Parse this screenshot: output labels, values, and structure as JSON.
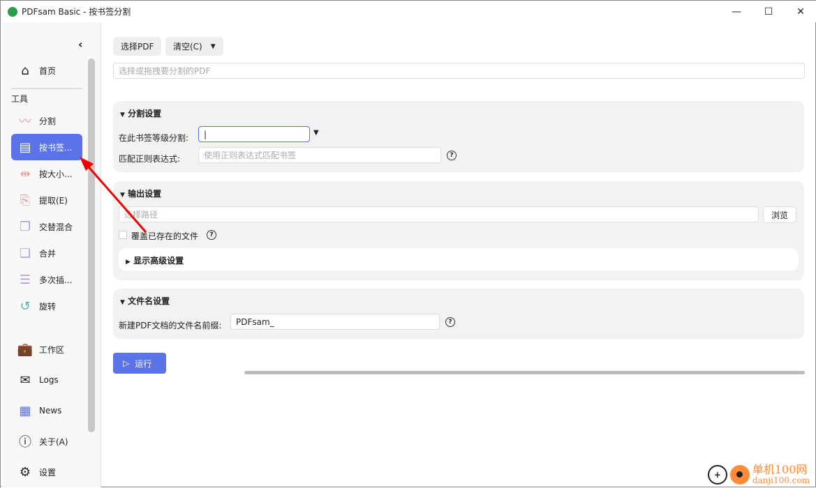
{
  "window": {
    "title": "PDFsam Basic - 按书签分割",
    "minimize": "—",
    "maximize": "☐",
    "close": "✕"
  },
  "sidebar": {
    "home": "首页",
    "section": "工具",
    "items": [
      {
        "label": "分割",
        "icon": "split-icon",
        "color": "#e89a9a"
      },
      {
        "label": "按书签...",
        "icon": "bookmark-split-icon",
        "color": "#ffffff"
      },
      {
        "label": "按大小...",
        "icon": "size-split-icon",
        "color": "#e89a9a"
      },
      {
        "label": "提取(E)",
        "icon": "extract-icon",
        "color": "#e89a9a"
      },
      {
        "label": "交替混合",
        "icon": "alternate-mix-icon",
        "color": "#b39ddb"
      },
      {
        "label": "合并",
        "icon": "merge-icon",
        "color": "#b39ddb"
      },
      {
        "label": "多次插...",
        "icon": "multi-insert-icon",
        "color": "#b39ddb"
      },
      {
        "label": "旋转",
        "icon": "rotate-icon",
        "color": "#4db6ac"
      }
    ],
    "bottom": [
      {
        "label": "工作区",
        "icon": "briefcase-icon"
      },
      {
        "label": "Logs",
        "icon": "logs-icon"
      },
      {
        "label": "News",
        "icon": "news-icon"
      },
      {
        "label": "关于(A)",
        "icon": "info-icon"
      },
      {
        "label": "设置",
        "icon": "gear-icon"
      }
    ]
  },
  "toolbar": {
    "select_pdf": "选择PDF",
    "clear": "清空(C)",
    "file_placeholder": "选择或拖拽要分割的PDF"
  },
  "split_settings": {
    "title": "分割设置",
    "level_label": "在此书签等级分割:",
    "level_value": "",
    "regex_label": "匹配正则表达式:",
    "regex_placeholder": "使用正则表达式匹配书签"
  },
  "output_settings": {
    "title": "输出设置",
    "path_placeholder": "选择路径",
    "browse": "浏览",
    "overwrite_label": "覆盖已存在的文件",
    "overwrite_checked": false,
    "advanced": "显示高级设置"
  },
  "filename_settings": {
    "title": "文件名设置",
    "prefix_label": "新建PDF文档的文件名前缀:",
    "prefix_value": "PDFsam_"
  },
  "run": "运行",
  "accent": "#5b73e8",
  "watermark": {
    "cn": "单机100网",
    "url": "danji100.com"
  }
}
